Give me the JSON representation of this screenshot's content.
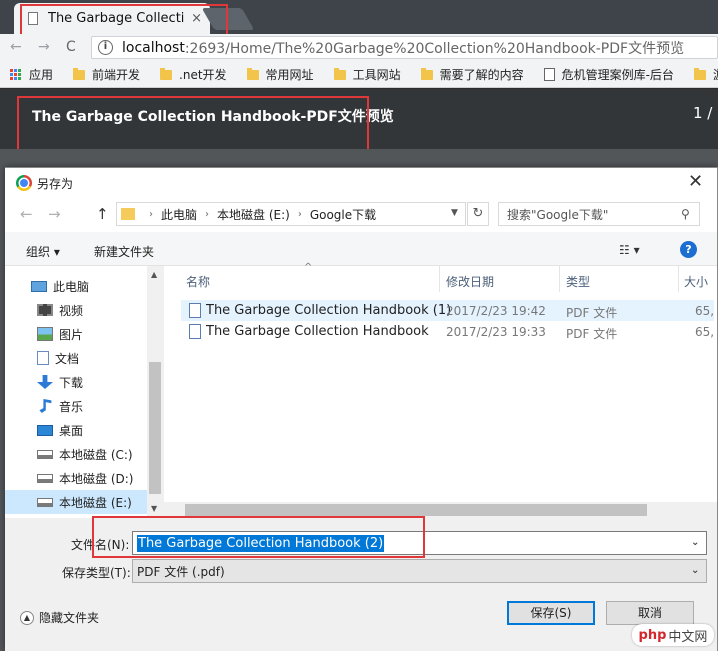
{
  "browser": {
    "tab_title": "The Garbage Collectio",
    "tab_close": "×",
    "url_host": "localhost",
    "url_path": ":2693/Home/The%20Garbage%20Collection%20Handbook-PDF文件预览",
    "info_icon": "i",
    "back": "←",
    "forward": "→",
    "reload": "C",
    "bookmarks": [
      {
        "label": "应用",
        "icon": "apps-icon"
      },
      {
        "label": "前端开发",
        "icon": "folder-icon"
      },
      {
        "label": ".net开发",
        "icon": "folder-icon"
      },
      {
        "label": "常用网址",
        "icon": "folder-icon"
      },
      {
        "label": "工具网站",
        "icon": "folder-icon"
      },
      {
        "label": "需要了解的内容",
        "icon": "folder-icon"
      },
      {
        "label": "危机管理案例库-后台",
        "icon": "page-icon"
      },
      {
        "label": "游戏开发",
        "icon": "folder-icon"
      }
    ]
  },
  "pdf_viewer": {
    "title": "The Garbage Collection Handbook-PDF文件预览",
    "page_indicator": "1 /"
  },
  "dialog": {
    "title": "另存为",
    "close": "✕",
    "path": [
      "此电脑",
      "本地磁盘 (E:)",
      "Google下载"
    ],
    "path_sep": "›",
    "search_placeholder": "搜索\"Google下载\"",
    "organize": "组织 ▾",
    "new_folder": "新建文件夹",
    "view_icon": "☷ ▾",
    "help": "?",
    "nav": [
      {
        "label": "此电脑",
        "icon": "computer-icon",
        "indent": 0
      },
      {
        "label": "视频",
        "icon": "video-icon",
        "indent": 1
      },
      {
        "label": "图片",
        "icon": "picture-icon",
        "indent": 1
      },
      {
        "label": "文档",
        "icon": "document-icon",
        "indent": 1
      },
      {
        "label": "下载",
        "icon": "download-icon",
        "indent": 1
      },
      {
        "label": "音乐",
        "icon": "music-icon",
        "indent": 1
      },
      {
        "label": "桌面",
        "icon": "desktop-icon",
        "indent": 1
      },
      {
        "label": "本地磁盘 (C:)",
        "icon": "drive-icon",
        "indent": 1
      },
      {
        "label": "本地磁盘 (D:)",
        "icon": "drive-icon",
        "indent": 1
      },
      {
        "label": "本地磁盘 (E:)",
        "icon": "drive-icon",
        "indent": 1,
        "selected": true
      }
    ],
    "columns": [
      "名称",
      "修改日期",
      "类型",
      "大小"
    ],
    "sort_arrow": "^",
    "files": [
      {
        "name": "The Garbage Collection Handbook (1)",
        "date": "2017/2/23 19:42",
        "type": "PDF 文件",
        "size": "65,"
      },
      {
        "name": "The Garbage Collection Handbook",
        "date": "2017/2/23 19:33",
        "type": "PDF 文件",
        "size": "65,"
      }
    ],
    "filename_label": "文件名(N):",
    "filename_value": "The Garbage Collection Handbook (2)",
    "filetype_label": "保存类型(T):",
    "filetype_value": "PDF 文件 (.pdf)",
    "hide_folders": "隐藏文件夹",
    "save": "保存(S)",
    "cancel": "取消",
    "dropdown_arrow": "⌄"
  },
  "watermark": {
    "brand": "php",
    "suffix": "中文网"
  },
  "colors": {
    "highlight": "#e0383a",
    "accent": "#0078d7"
  }
}
